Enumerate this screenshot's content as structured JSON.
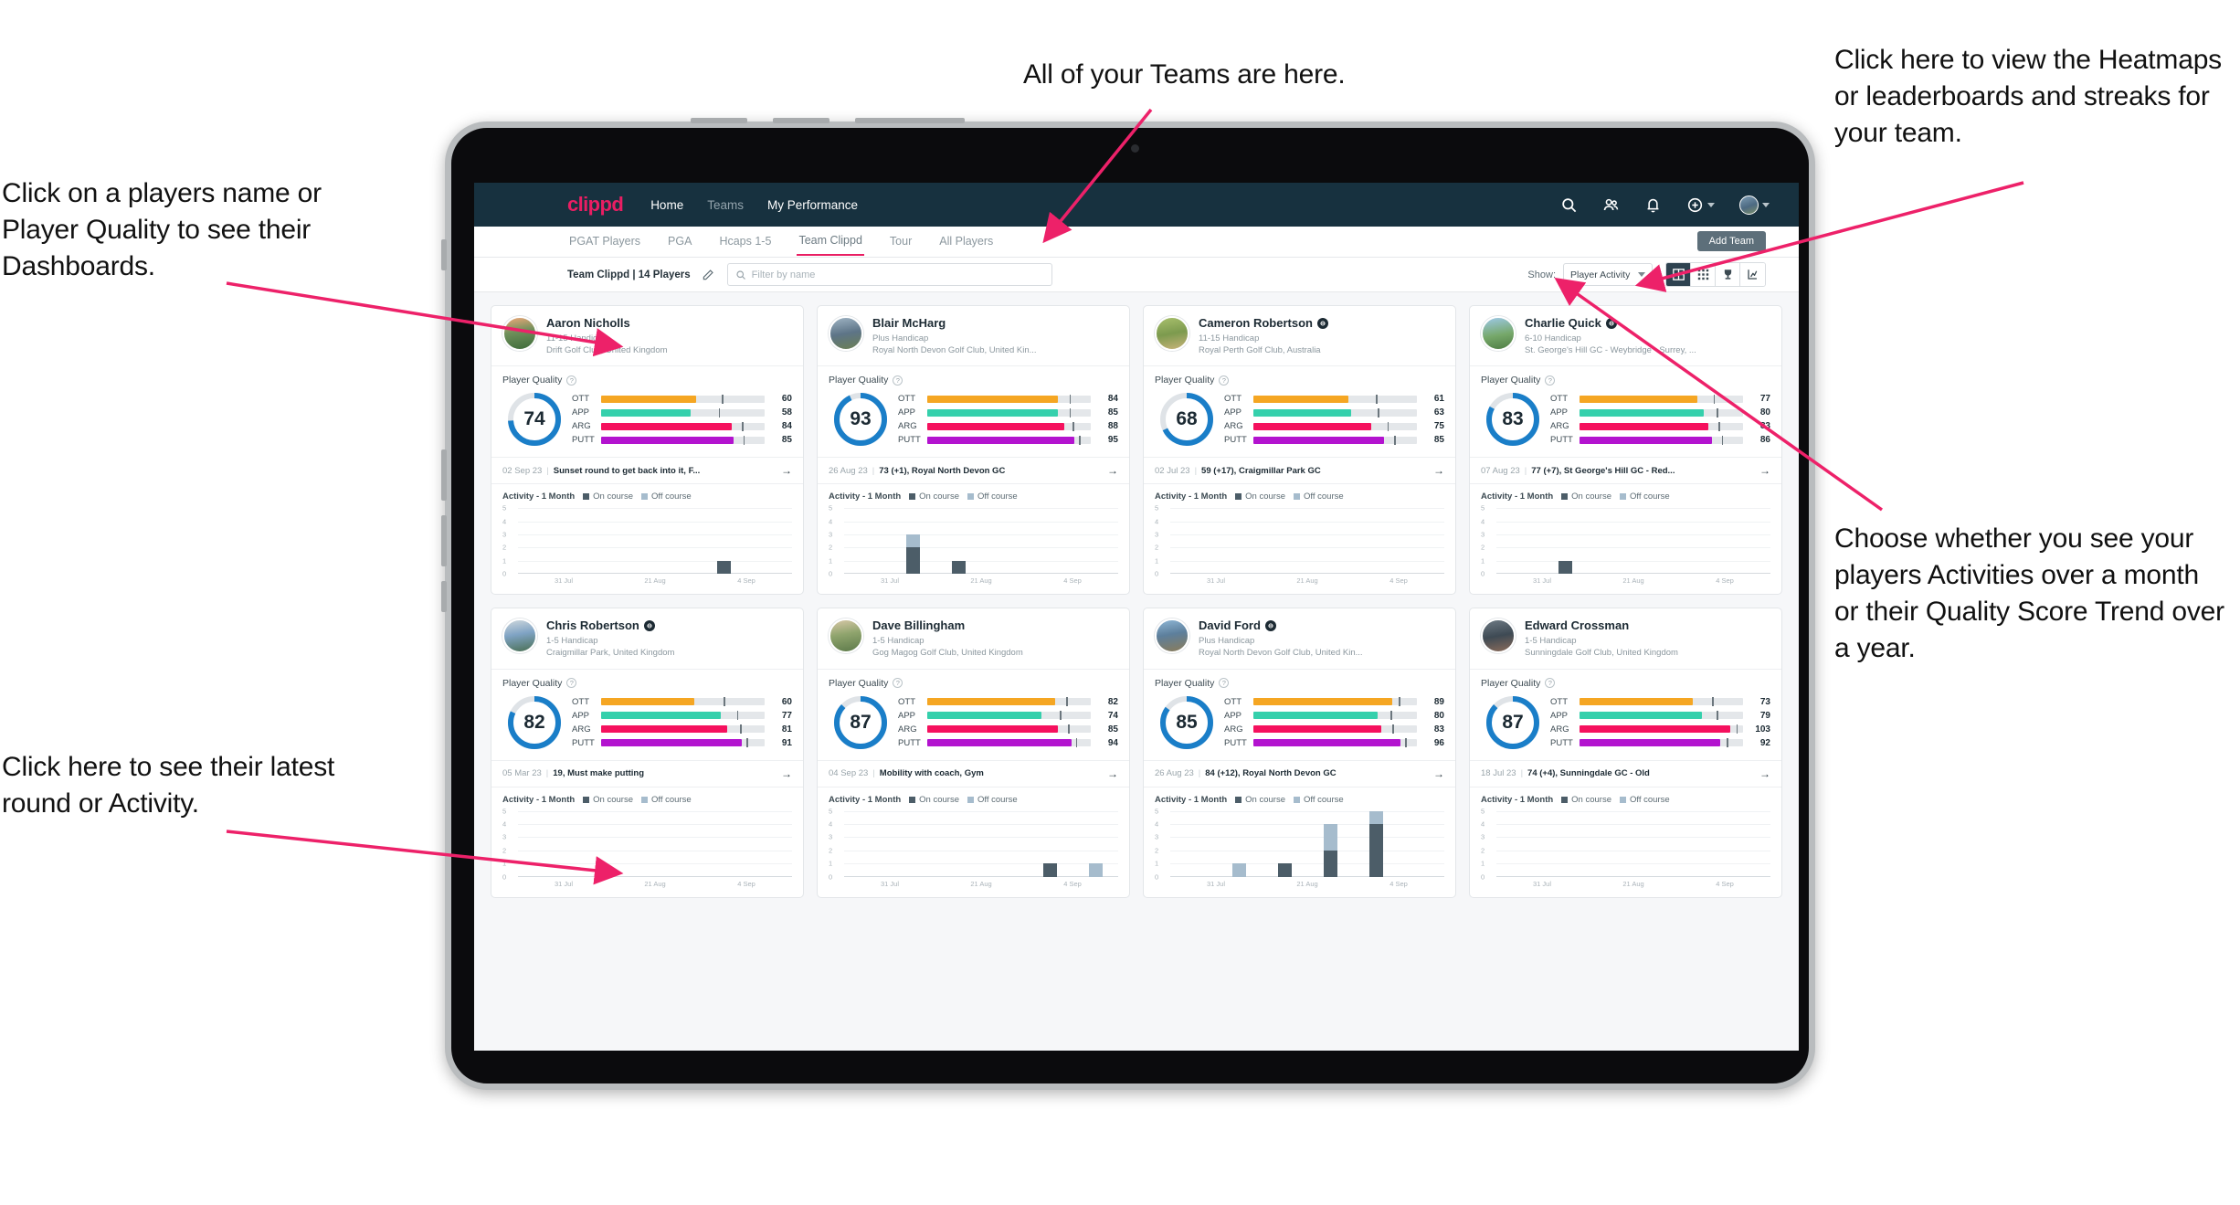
{
  "annotations": {
    "left_top": "Click on a players name or Player Quality to see their Dashboards.",
    "left_bottom": "Click here to see their latest round or Activity.",
    "top_center": "All of your Teams are here.",
    "right_top": "Click here to view the Heatmaps or leaderboards and streaks for your team.",
    "right_bottom": "Choose whether you see your players Activities over a month or their Quality Score Trend over a year."
  },
  "topnav": {
    "brand": "clippd",
    "links": [
      {
        "label": "Home",
        "dim": false
      },
      {
        "label": "Teams",
        "dim": true
      },
      {
        "label": "My Performance",
        "dim": false
      }
    ],
    "icons": [
      "search-icon",
      "people-icon",
      "bell-icon",
      "plus-circle-icon",
      "avatar"
    ]
  },
  "tabs": [
    {
      "label": "PGAT Players",
      "active": false
    },
    {
      "label": "PGA",
      "active": false
    },
    {
      "label": "Hcaps 1-5",
      "active": false
    },
    {
      "label": "Team Clippd",
      "active": true
    },
    {
      "label": "Tour",
      "active": false
    },
    {
      "label": "All Players",
      "active": false
    }
  ],
  "add_team_label": "Add Team",
  "toolbar": {
    "team_label": "Team Clippd | 14 Players",
    "search_placeholder": "Filter by name",
    "search_value": "",
    "show_label": "Show:",
    "show_value": "Player Activity",
    "view_icons": [
      "card-view-icon",
      "grid-view-icon",
      "trophy-icon",
      "streak-icon"
    ],
    "active_view": 0
  },
  "chart_legend": {
    "title": "Activity - 1 Month",
    "on": "On course",
    "off": "Off course"
  },
  "chart_axis": {
    "yticks": [
      5,
      4,
      3,
      2,
      1,
      0
    ],
    "xticks": [
      "31 Jul",
      "21 Aug",
      "4 Sep"
    ],
    "ylim": [
      0,
      5
    ],
    "slots": 6
  },
  "players": [
    {
      "name": "Aaron Nicholls",
      "verified": false,
      "handicap": "11-15 Handicap",
      "club": "Drift Golf Club, United Kingdom",
      "quality_label": "Player Quality",
      "quality": 74,
      "metrics": [
        {
          "label": "OTT",
          "value": 60,
          "fill": 58,
          "tick": 74,
          "color": "#f5a623"
        },
        {
          "label": "APP",
          "value": 58,
          "fill": 55,
          "tick": 72,
          "color": "#35d0ac"
        },
        {
          "label": "ARG",
          "value": 84,
          "fill": 80,
          "tick": 86,
          "color": "#f5115e"
        },
        {
          "label": "PUTT",
          "value": 85,
          "fill": 81,
          "tick": 87,
          "color": "#b313cf"
        }
      ],
      "round": {
        "date": "02 Sep 23",
        "text": "Sunset round to get back into it, F..."
      },
      "chart_data": {
        "type": "bar",
        "stacked": true,
        "on": [
          0,
          0,
          0,
          0,
          1,
          0
        ],
        "off": [
          0,
          0,
          0,
          0,
          0,
          0
        ]
      }
    },
    {
      "name": "Blair McHarg",
      "verified": false,
      "handicap": "Plus Handicap",
      "club": "Royal North Devon Golf Club, United Kin...",
      "quality_label": "Player Quality",
      "quality": 93,
      "metrics": [
        {
          "label": "OTT",
          "value": 84,
          "fill": 80,
          "tick": 87,
          "color": "#f5a623"
        },
        {
          "label": "APP",
          "value": 85,
          "fill": 80,
          "tick": 87,
          "color": "#35d0ac"
        },
        {
          "label": "ARG",
          "value": 88,
          "fill": 84,
          "tick": 89,
          "color": "#f5115e"
        },
        {
          "label": "PUTT",
          "value": 95,
          "fill": 90,
          "tick": 93,
          "color": "#b313cf"
        }
      ],
      "round": {
        "date": "26 Aug 23",
        "text": "73 (+1), Royal North Devon GC"
      },
      "chart_data": {
        "type": "bar",
        "stacked": true,
        "on": [
          0,
          2,
          1,
          0,
          0,
          0
        ],
        "off": [
          0,
          1,
          0,
          0,
          0,
          0
        ]
      }
    },
    {
      "name": "Cameron Robertson",
      "verified": true,
      "handicap": "11-15 Handicap",
      "club": "Royal Perth Golf Club, Australia",
      "quality_label": "Player Quality",
      "quality": 68,
      "metrics": [
        {
          "label": "OTT",
          "value": 61,
          "fill": 58,
          "tick": 75,
          "color": "#f5a623"
        },
        {
          "label": "APP",
          "value": 63,
          "fill": 60,
          "tick": 76,
          "color": "#35d0ac"
        },
        {
          "label": "ARG",
          "value": 75,
          "fill": 72,
          "tick": 82,
          "color": "#f5115e"
        },
        {
          "label": "PUTT",
          "value": 85,
          "fill": 80,
          "tick": 86,
          "color": "#b313cf"
        }
      ],
      "round": {
        "date": "02 Jul 23",
        "text": "59 (+17), Craigmillar Park GC"
      },
      "chart_data": {
        "type": "bar",
        "stacked": true,
        "on": [
          0,
          0,
          0,
          0,
          0,
          0
        ],
        "off": [
          0,
          0,
          0,
          0,
          0,
          0
        ]
      }
    },
    {
      "name": "Charlie Quick",
      "verified": true,
      "handicap": "6-10 Handicap",
      "club": "St. George's Hill GC - Weybridge - Surrey, ...",
      "quality_label": "Player Quality",
      "quality": 83,
      "metrics": [
        {
          "label": "OTT",
          "value": 77,
          "fill": 72,
          "tick": 82,
          "color": "#f5a623"
        },
        {
          "label": "APP",
          "value": 80,
          "fill": 76,
          "tick": 84,
          "color": "#35d0ac"
        },
        {
          "label": "ARG",
          "value": 83,
          "fill": 79,
          "tick": 85,
          "color": "#f5115e"
        },
        {
          "label": "PUTT",
          "value": 86,
          "fill": 81,
          "tick": 87,
          "color": "#b313cf"
        }
      ],
      "round": {
        "date": "07 Aug 23",
        "text": "77 (+7), St George's Hill GC - Red..."
      },
      "chart_data": {
        "type": "bar",
        "stacked": true,
        "on": [
          0,
          1,
          0,
          0,
          0,
          0
        ],
        "off": [
          0,
          0,
          0,
          0,
          0,
          0
        ]
      }
    },
    {
      "name": "Chris Robertson",
      "verified": true,
      "handicap": "1-5 Handicap",
      "club": "Craigmillar Park, United Kingdom",
      "quality_label": "Player Quality",
      "quality": 82,
      "metrics": [
        {
          "label": "OTT",
          "value": 60,
          "fill": 57,
          "tick": 75,
          "color": "#f5a623"
        },
        {
          "label": "APP",
          "value": 77,
          "fill": 73,
          "tick": 83,
          "color": "#35d0ac"
        },
        {
          "label": "ARG",
          "value": 81,
          "fill": 77,
          "tick": 85,
          "color": "#f5115e"
        },
        {
          "label": "PUTT",
          "value": 91,
          "fill": 86,
          "tick": 89,
          "color": "#b313cf"
        }
      ],
      "round": {
        "date": "05 Mar 23",
        "text": "19, Must make putting"
      },
      "chart_data": {
        "type": "bar",
        "stacked": true,
        "on": [
          0,
          0,
          0,
          0,
          0,
          0
        ],
        "off": [
          0,
          0,
          0,
          0,
          0,
          0
        ]
      }
    },
    {
      "name": "Dave Billingham",
      "verified": false,
      "handicap": "1-5 Handicap",
      "club": "Gog Magog Golf Club, United Kingdom",
      "quality_label": "Player Quality",
      "quality": 87,
      "metrics": [
        {
          "label": "OTT",
          "value": 82,
          "fill": 78,
          "tick": 85,
          "color": "#f5a623"
        },
        {
          "label": "APP",
          "value": 74,
          "fill": 70,
          "tick": 81,
          "color": "#35d0ac"
        },
        {
          "label": "ARG",
          "value": 85,
          "fill": 80,
          "tick": 86,
          "color": "#f5115e"
        },
        {
          "label": "PUTT",
          "value": 94,
          "fill": 88,
          "tick": 91,
          "color": "#b313cf"
        }
      ],
      "round": {
        "date": "04 Sep 23",
        "text": "Mobility with coach, Gym"
      },
      "chart_data": {
        "type": "bar",
        "stacked": true,
        "on": [
          0,
          0,
          0,
          0,
          1,
          0
        ],
        "off": [
          0,
          0,
          0,
          0,
          0,
          1
        ]
      }
    },
    {
      "name": "David Ford",
      "verified": true,
      "handicap": "Plus Handicap",
      "club": "Royal North Devon Golf Club, United Kin...",
      "quality_label": "Player Quality",
      "quality": 85,
      "metrics": [
        {
          "label": "OTT",
          "value": 89,
          "fill": 85,
          "tick": 89,
          "color": "#f5a623"
        },
        {
          "label": "APP",
          "value": 80,
          "fill": 76,
          "tick": 84,
          "color": "#35d0ac"
        },
        {
          "label": "ARG",
          "value": 83,
          "fill": 78,
          "tick": 85,
          "color": "#f5115e"
        },
        {
          "label": "PUTT",
          "value": 96,
          "fill": 90,
          "tick": 93,
          "color": "#b313cf"
        }
      ],
      "round": {
        "date": "26 Aug 23",
        "text": "84 (+12), Royal North Devon GC"
      },
      "chart_data": {
        "type": "bar",
        "stacked": true,
        "on": [
          0,
          0,
          1,
          2,
          4,
          0
        ],
        "off": [
          0,
          1,
          0,
          2,
          1,
          0
        ]
      }
    },
    {
      "name": "Edward Crossman",
      "verified": false,
      "handicap": "1-5 Handicap",
      "club": "Sunningdale Golf Club, United Kingdom",
      "quality_label": "Player Quality",
      "quality": 87,
      "metrics": [
        {
          "label": "OTT",
          "value": 73,
          "fill": 69,
          "tick": 81,
          "color": "#f5a623"
        },
        {
          "label": "APP",
          "value": 79,
          "fill": 75,
          "tick": 84,
          "color": "#35d0ac"
        },
        {
          "label": "ARG",
          "value": 103,
          "fill": 92,
          "tick": 96,
          "color": "#f5115e"
        },
        {
          "label": "PUTT",
          "value": 92,
          "fill": 86,
          "tick": 90,
          "color": "#b313cf"
        }
      ],
      "round": {
        "date": "18 Jul 23",
        "text": "74 (+4), Sunningdale GC - Old"
      },
      "chart_data": {
        "type": "bar",
        "stacked": true,
        "on": [
          0,
          0,
          0,
          0,
          0,
          0
        ],
        "off": [
          0,
          0,
          0,
          0,
          0,
          0
        ]
      }
    }
  ],
  "colors": {
    "accent": "#e91e63",
    "navy": "#17313f",
    "ring": "#1a7ec8",
    "ring_track": "#dfe3e7"
  }
}
